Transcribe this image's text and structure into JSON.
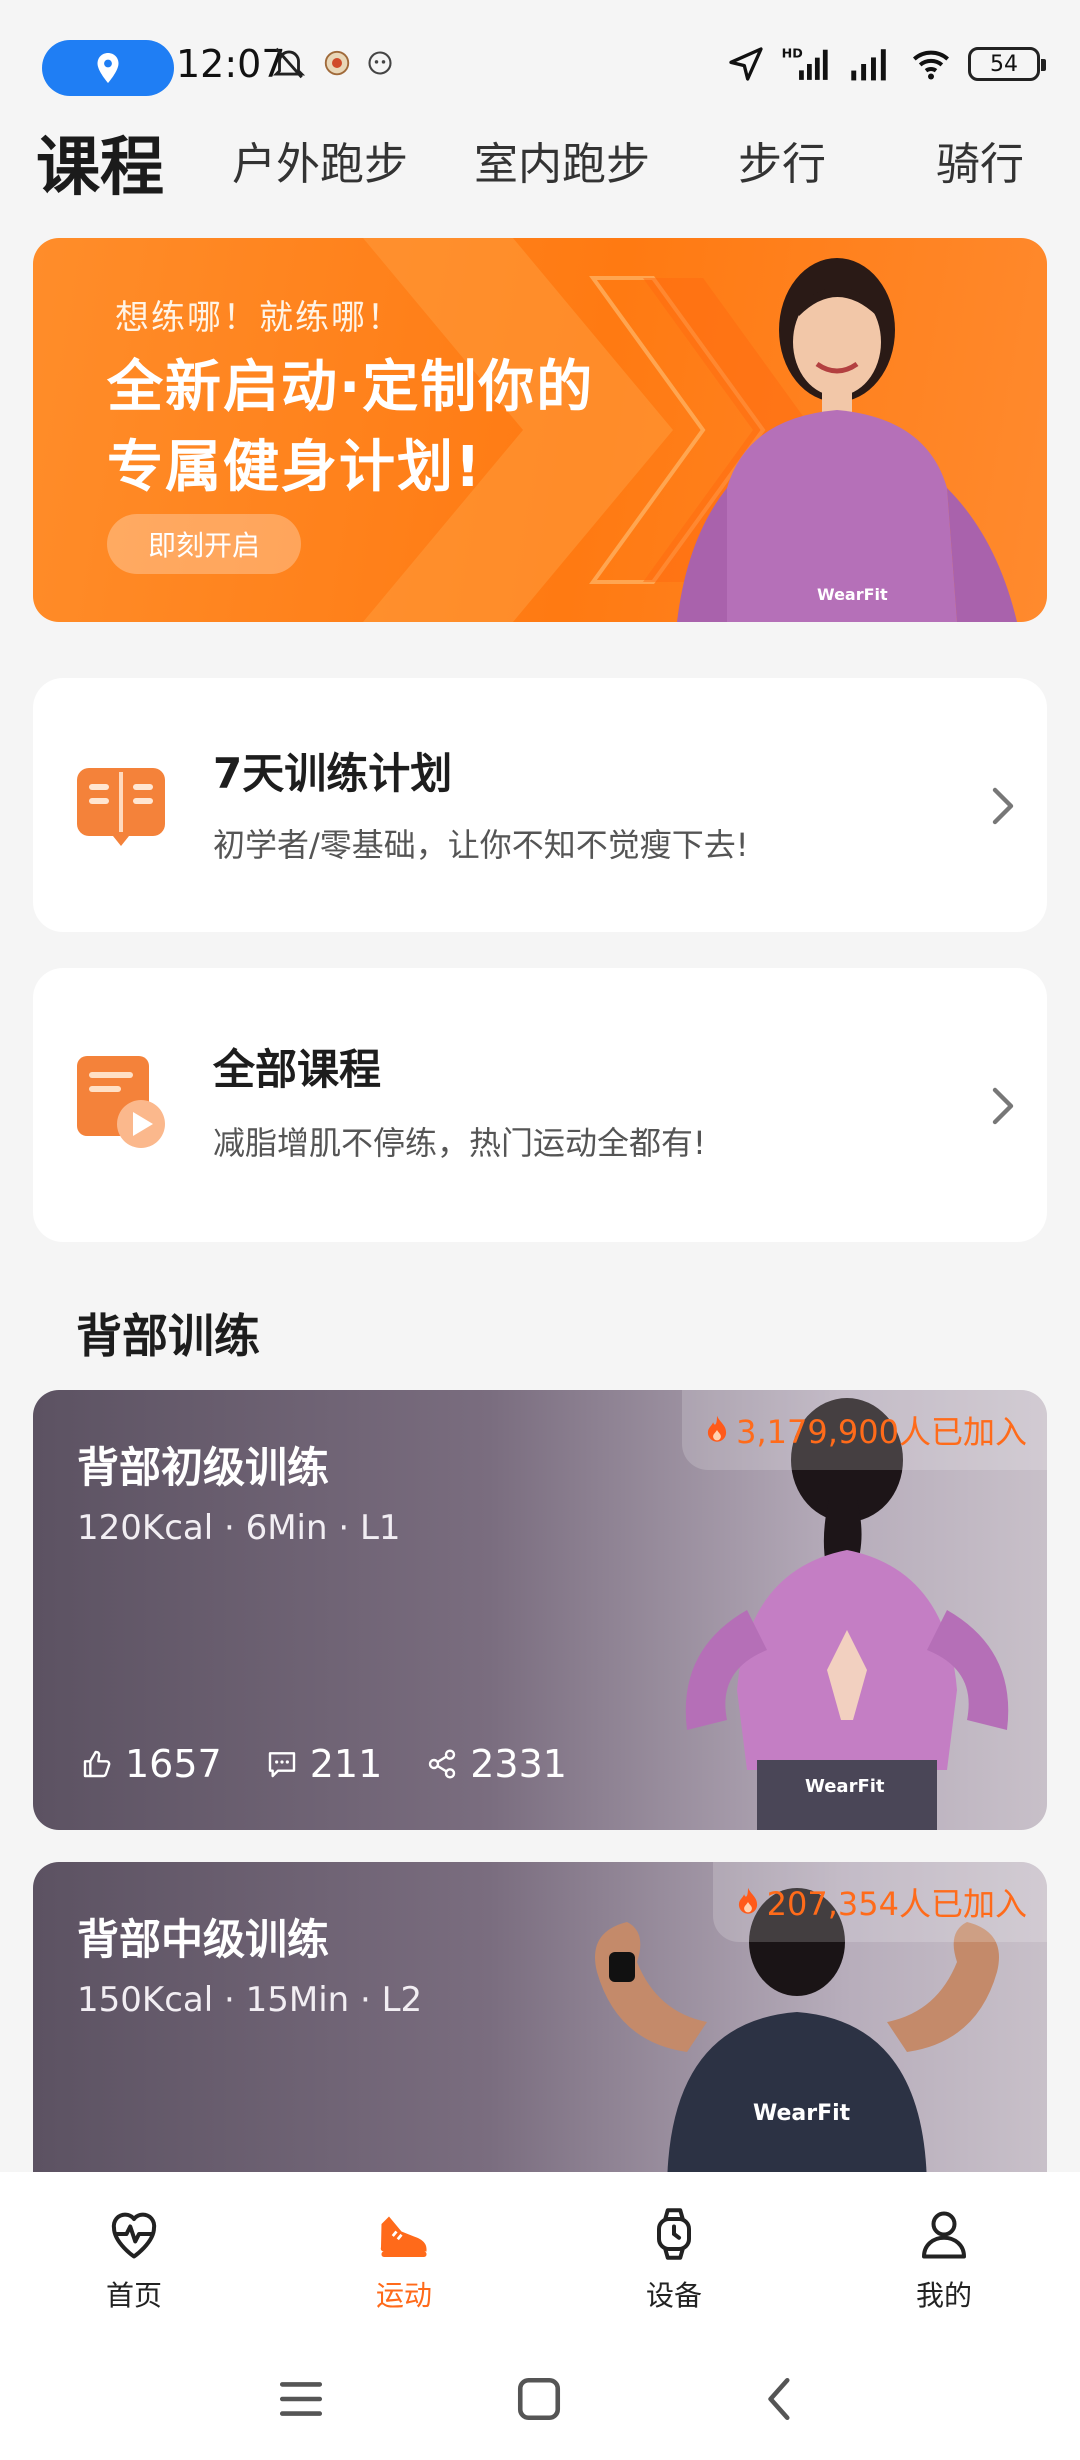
{
  "status": {
    "time": "12:07",
    "battery": "54",
    "network_label": "HD"
  },
  "header": {
    "title": "课程",
    "tabs": [
      "户外跑步",
      "室内跑步",
      "步行",
      "骑行"
    ]
  },
  "banner": {
    "kicker": "想练哪！就练哪！",
    "title_line1": "全新启动·定制你的",
    "title_line2": "专属健身计划!",
    "button": "即刻开启",
    "brand": "WearFit"
  },
  "cards": {
    "plan": {
      "title": "7天训练计划",
      "subtitle": "初学者/零基础，让你不知不觉瘦下去!"
    },
    "all": {
      "title": "全部课程",
      "subtitle": "减脂增肌不停练，热门运动全都有!"
    }
  },
  "section": {
    "title": "背部训练"
  },
  "workouts": [
    {
      "joined": "3,179,900人已加入",
      "title": "背部初级训练",
      "meta": "120Kcal  ·  6Min  ·  L1",
      "likes": "1657",
      "comments": "211",
      "shares": "2331"
    },
    {
      "joined": "207,354人已加入",
      "title": "背部中级训练",
      "meta": "150Kcal  ·  15Min  ·  L2"
    }
  ],
  "nav": {
    "items": [
      "首页",
      "运动",
      "设备",
      "我的"
    ],
    "active": "运动"
  },
  "colors": {
    "accent": "#ff6a1a",
    "banner": "#ff7a12",
    "location_pill": "#1f7ef4",
    "background": "#f5f5f5"
  }
}
